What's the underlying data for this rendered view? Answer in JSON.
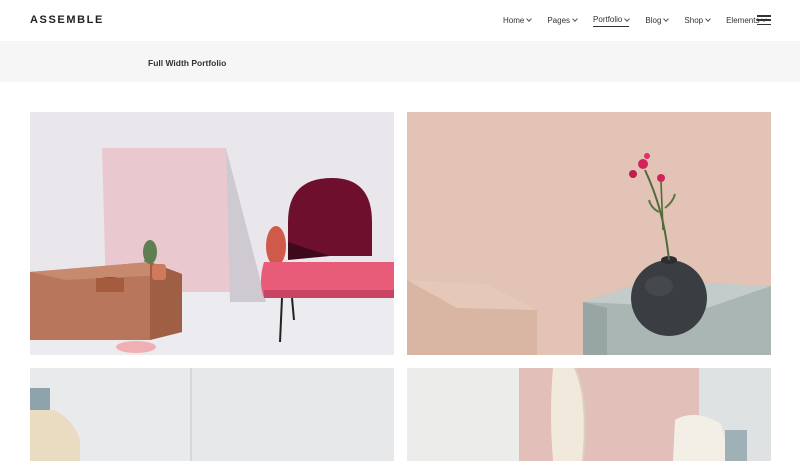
{
  "header": {
    "logo": "ASSEMBLE",
    "nav": [
      "Home",
      "Pages",
      "Portfolio",
      "Blog",
      "Shop",
      "Elements"
    ],
    "active": "Portfolio"
  },
  "titlebar": {
    "title": "Full Width Portfolio"
  },
  "portfolio": {
    "items": [
      {
        "icon": "chair-photo"
      },
      {
        "icon": "vase-photo"
      },
      {
        "icon": "lamp-photo"
      },
      {
        "icon": "towel-photo"
      }
    ]
  },
  "colors": {
    "header_bg": "#ffffff",
    "titlebar_bg": "#f6f6f6",
    "text": "#222222"
  }
}
